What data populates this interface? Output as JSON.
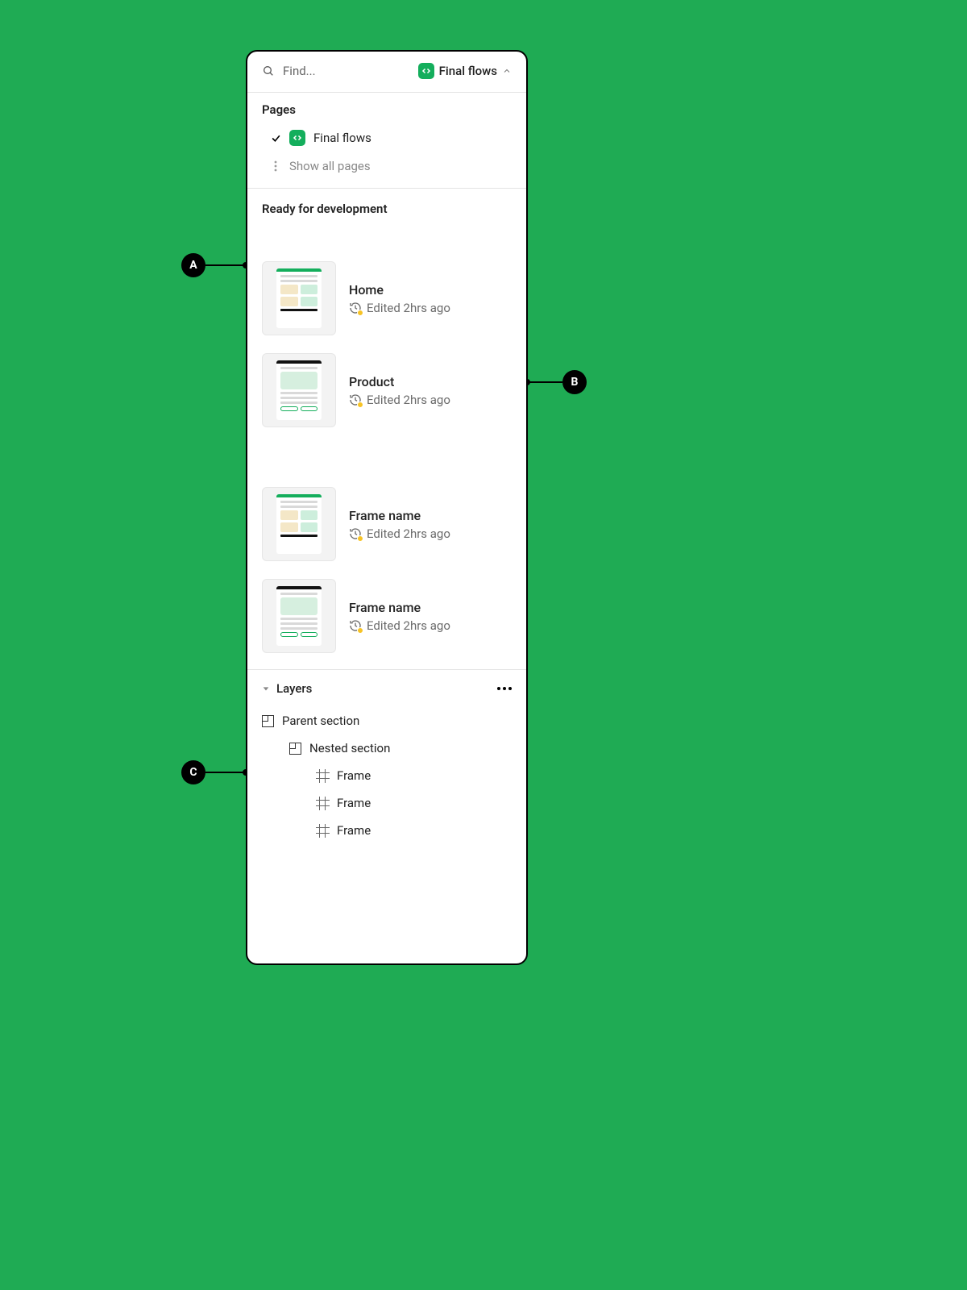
{
  "search": {
    "placeholder": "Find..."
  },
  "pageSelector": {
    "label": "Final flows"
  },
  "pagesSection": {
    "title": "Pages",
    "current": "Final flows",
    "showAll": "Show all pages"
  },
  "readySection": {
    "title": "Ready for development"
  },
  "frames": [
    {
      "name": "Home",
      "edited": "Edited 2hrs ago",
      "thumbStyle": "home"
    },
    {
      "name": "Product",
      "edited": "Edited 2hrs ago",
      "thumbStyle": "product"
    },
    {
      "name": "Frame name",
      "edited": "Edited 2hrs ago",
      "thumbStyle": "home"
    },
    {
      "name": "Frame name",
      "edited": "Edited 2hrs ago",
      "thumbStyle": "product"
    }
  ],
  "layers": {
    "title": "Layers",
    "tree": {
      "parent": "Parent section",
      "nested": "Nested section",
      "frames": [
        "Frame",
        "Frame",
        "Frame"
      ]
    }
  },
  "annotations": {
    "A": "A",
    "B": "B",
    "C": "C"
  }
}
